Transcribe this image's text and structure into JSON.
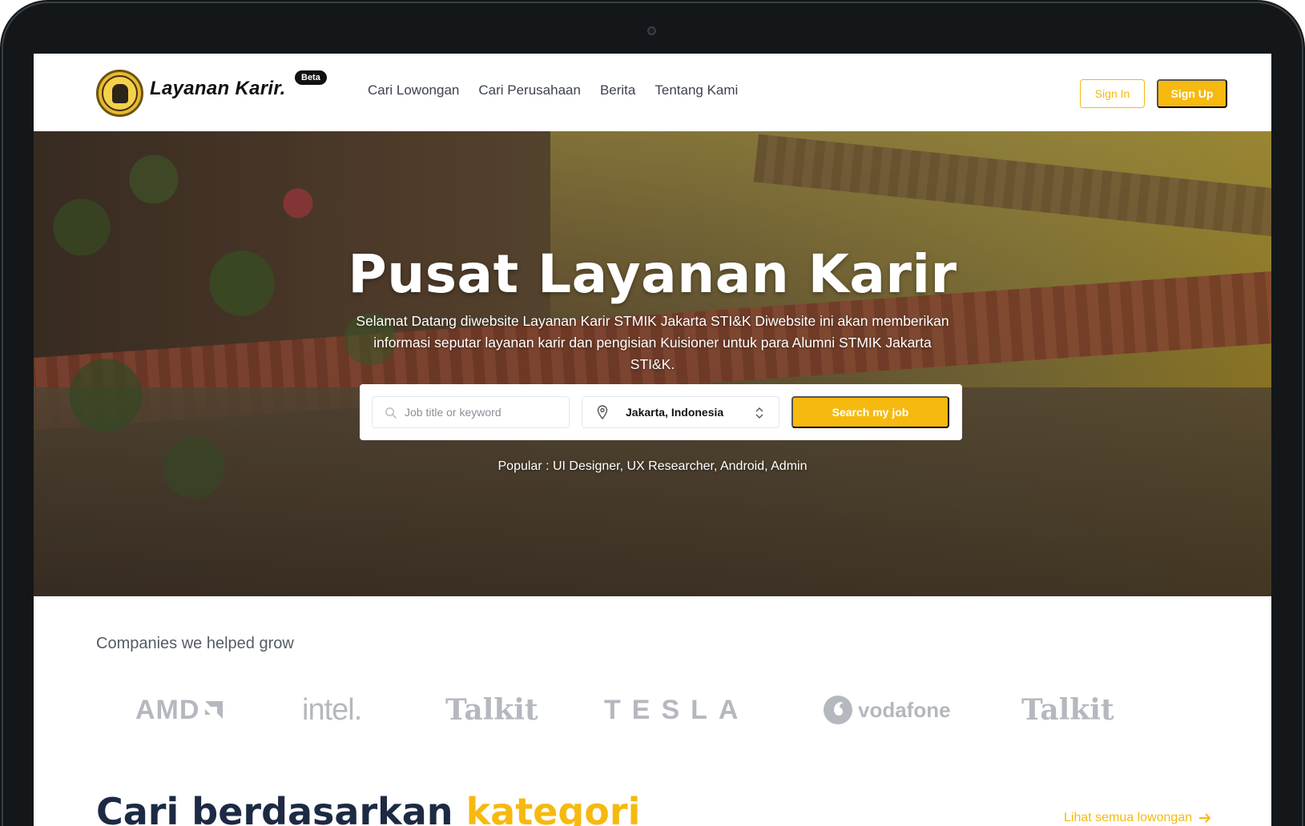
{
  "navbar": {
    "brand": "Layanan Karir.",
    "badge": "Beta",
    "links": [
      "Cari Lowongan",
      "Cari Perusahaan",
      "Berita",
      "Tentang Kami"
    ],
    "sign_in": "Sign In",
    "sign_up": "Sign Up"
  },
  "hero": {
    "title": "Pusat Layanan Karir",
    "description": "Selamat Datang diwebsite Layanan Karir STMIK Jakarta STI&K Diwebsite ini akan memberikan informasi seputar layanan karir dan pengisian Kuisioner untuk para Alumni STMIK Jakarta STI&K.",
    "search": {
      "placeholder": "Job title or keyword",
      "location": "Jakarta, Indonesia",
      "button": "Search my job"
    },
    "popular": "Popular : UI Designer, UX Researcher, Android, Admin"
  },
  "companies": {
    "title": "Companies we helped grow",
    "logos": [
      "AMD",
      "intel.",
      "Talkit",
      "TESLA",
      "vodafone",
      "Talkit"
    ]
  },
  "category": {
    "title_main": "Cari berdasarkan ",
    "title_accent": "kategori",
    "see_all": "Lihat semua lowongan"
  },
  "colors": {
    "accent": "#f6b90f",
    "heading": "#1d2a44",
    "frame": "#141719"
  },
  "icons": {
    "search": "search-icon",
    "location": "map-pin-icon",
    "select": "chevron-up-down-icon",
    "arrow": "arrow-right-icon"
  }
}
